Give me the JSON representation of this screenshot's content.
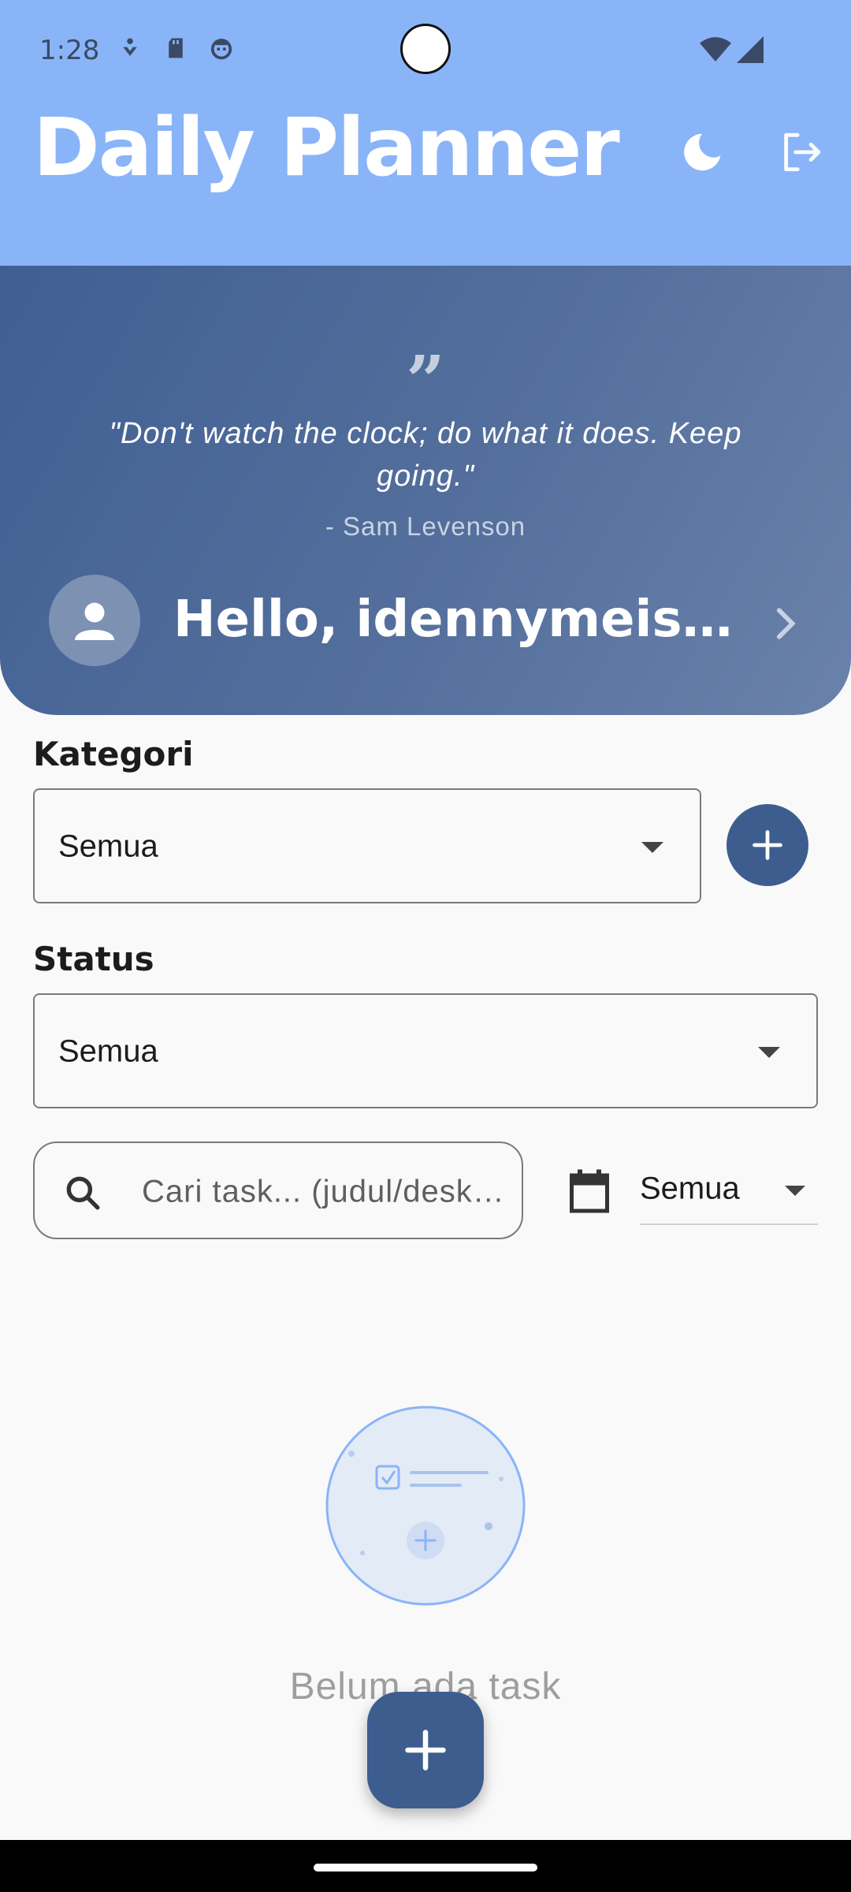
{
  "status_bar": {
    "time": "1:28"
  },
  "header": {
    "title": "Daily Planner"
  },
  "quote": {
    "mark": "”",
    "text": "\"Don't watch the clock; do what it does. Keep going.\"",
    "author": "- Sam Levenson"
  },
  "greeting": "Hello, idennymeister...",
  "filters": {
    "category_label": "Kategori",
    "category_value": "Semua",
    "status_label": "Status",
    "status_value": "Semua",
    "search_placeholder": "Cari task... (judul/deskripsi)",
    "date_value": "Semua"
  },
  "empty_state": {
    "text": "Belum ada task"
  },
  "colors": {
    "header": "#8ab4f8",
    "primary": "#3d5d8f",
    "background": "#f9f9f9"
  },
  "icons": [
    "moon-icon",
    "logout-icon",
    "person-icon",
    "chevron-right-icon",
    "plus-icon",
    "search-icon",
    "calendar-icon"
  ]
}
